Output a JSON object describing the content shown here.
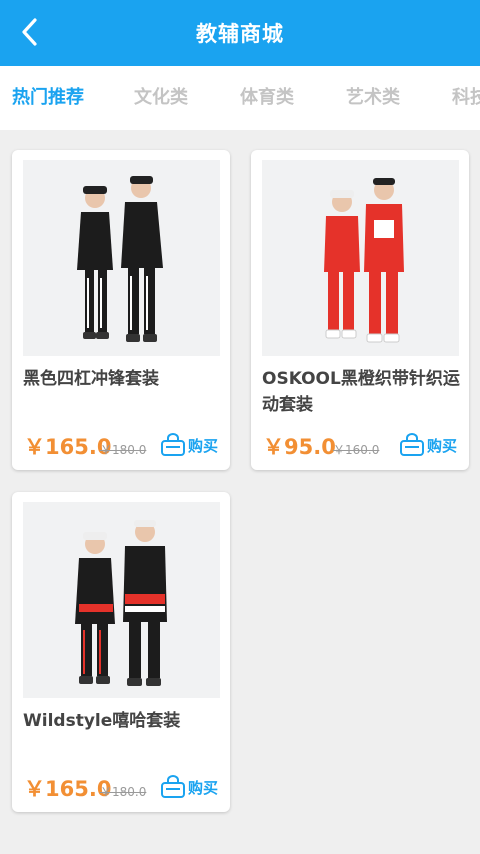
{
  "header": {
    "title": "教辅商城",
    "back_icon": "back-arrow-icon"
  },
  "tabs": [
    {
      "label": "热门推荐",
      "active": true
    },
    {
      "label": "文化类",
      "active": false
    },
    {
      "label": "体育类",
      "active": false
    },
    {
      "label": "艺术类",
      "active": false
    },
    {
      "label": "科技",
      "active": false
    }
  ],
  "products": [
    {
      "name": "黑色四杠冲锋套装",
      "price": "￥165.0",
      "old_price": "￥180.0",
      "buy_label": "购买",
      "buy_icon": "shopping-basket-icon"
    },
    {
      "name": "OSKOOL黑橙织带针织运动套装",
      "price": "￥95.0",
      "old_price": "￥160.0",
      "buy_label": "购买",
      "buy_icon": "shopping-basket-icon"
    },
    {
      "name": "Wildstyle嘻哈套装",
      "price": "￥165.0",
      "old_price": "￥180.0",
      "buy_label": "购买",
      "buy_icon": "shopping-basket-icon"
    }
  ],
  "colors": {
    "accent": "#1aa3f0",
    "price": "#f28f34"
  }
}
